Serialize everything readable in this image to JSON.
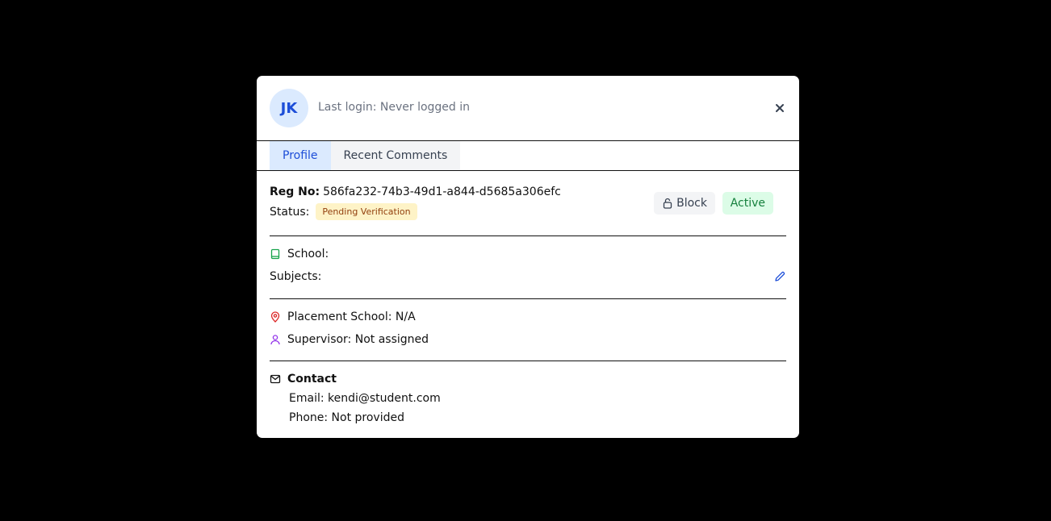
{
  "header": {
    "avatar_initials": "JK",
    "last_login": "Last login: Never logged in"
  },
  "tabs": [
    {
      "label": "Profile"
    },
    {
      "label": "Recent Comments"
    }
  ],
  "registration": {
    "label": "Reg No:",
    "value": "586fa232-74b3-49d1-a844-d5685a306efc"
  },
  "status": {
    "label": "Status:",
    "badge": "Pending Verification"
  },
  "actions": {
    "block_label": "Block",
    "active_label": "Active"
  },
  "academic": {
    "school_label": "School:",
    "subjects_label": "Subjects:"
  },
  "placement": {
    "school_text": "Placement School: N/A",
    "supervisor_text": "Supervisor: Not assigned"
  },
  "contact": {
    "title": "Contact",
    "email_text": "Email: kendi@student.com",
    "phone_text": "Phone: Not provided"
  },
  "colors": {
    "accent": "#1d4ed8",
    "active_green": "#15803d",
    "pending_bg": "#fef3c7"
  }
}
